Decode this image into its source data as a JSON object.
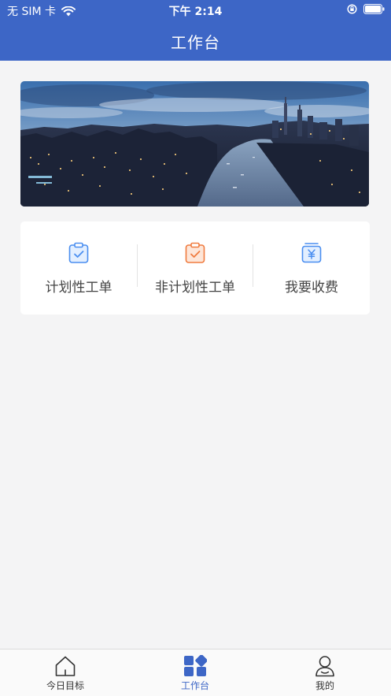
{
  "status_bar": {
    "carrier": "无 SIM 卡",
    "time": "下午 2:14"
  },
  "header": {
    "title": "工作台"
  },
  "banner": {
    "image": "city-skyline-at-dusk"
  },
  "quick_actions": [
    {
      "label": "计划性工单",
      "icon": "clipboard-check-icon",
      "color": "#4a8ef0"
    },
    {
      "label": "非计划性工单",
      "icon": "clipboard-check-icon",
      "color": "#f07b3f"
    },
    {
      "label": "我要收费",
      "icon": "yuan-payment-icon",
      "color": "#4a8ef0"
    }
  ],
  "tabs": [
    {
      "label": "今日目标",
      "icon": "home-icon",
      "active": false
    },
    {
      "label": "工作台",
      "icon": "grid-icon",
      "active": true
    },
    {
      "label": "我的",
      "icon": "user-icon",
      "active": false
    }
  ],
  "colors": {
    "brand": "#3d66c6",
    "page_bg": "#f4f4f5"
  }
}
